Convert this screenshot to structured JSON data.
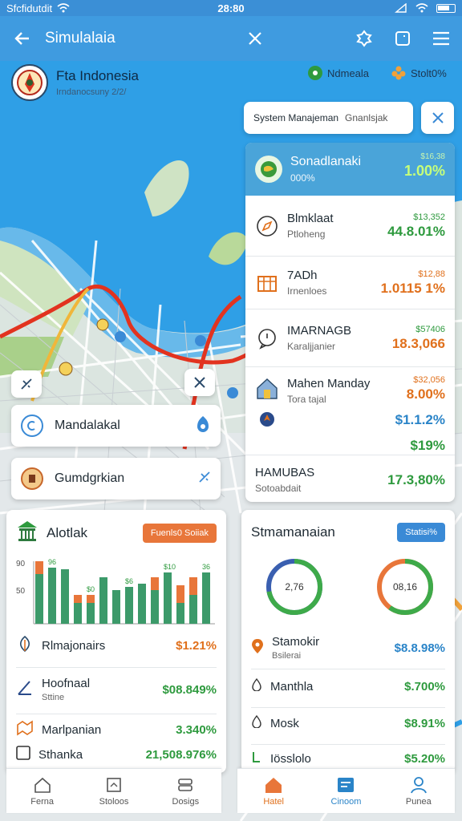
{
  "status_bar": {
    "carrier": "Sfcfidutdit",
    "time": "28:80"
  },
  "app_bar": {
    "title": "Simulalaia"
  },
  "location": {
    "title": "Fta Indonesia",
    "subtitle": "Irndanocsuny 2/2/"
  },
  "chips": {
    "left": "Ndmeala",
    "right": "Stolt0%"
  },
  "system_bar": {
    "label": "System Manajeman",
    "muted": "Gnanlsjak"
  },
  "region_list": {
    "header": {
      "title": "Sonadlanaki",
      "subtitle": "000%",
      "small": "$16,38",
      "value": "1.00%"
    },
    "rows": [
      {
        "title": "Blmklaat",
        "subtitle": "Ptloheng",
        "small": "$13,352",
        "value": "44.8.01%",
        "small_color": "#2e9a3e",
        "value_color": "#2e9a3e"
      },
      {
        "title": "7ADh",
        "subtitle": "Irnenloes",
        "small": "$12,88",
        "value": "1.0115 1%",
        "small_color": "#e0701c",
        "value_color": "#e0701c"
      },
      {
        "title": "IMARNAGB",
        "subtitle": "Karaljjanier",
        "small": "$57406",
        "value": "18.3,066",
        "small_color": "#2e9a3e",
        "value_color": "#e0701c"
      },
      {
        "title": "Mahen Manday",
        "subtitle": "Tora tajal",
        "small": "$32,056",
        "value": "8.00%",
        "value2": "$1.1.2%",
        "value3": "$19%",
        "small_color": "#e0701c",
        "value_color": "#e0701c"
      },
      {
        "title": "HAMUBAS",
        "subtitle": "Sotoabdait",
        "small": "",
        "value": "17.3,80%",
        "small_color": "#2e9a3e",
        "value_color": "#2e9a3e"
      }
    ]
  },
  "pills": [
    {
      "label": "Mandalakal"
    },
    {
      "label": "Gumdgrkian"
    }
  ],
  "analytics": {
    "title": "Alotlak",
    "badge": "Fuenls0 Soiiak",
    "y_labels": [
      "90",
      "50"
    ],
    "bar_labels": [
      "96",
      "$0",
      "$6",
      "$10",
      "36"
    ],
    "bars": [
      {
        "green": 62,
        "orange": 16
      },
      {
        "green": 70,
        "orange": 0
      },
      {
        "green": 68,
        "orange": 0
      },
      {
        "green": 26,
        "orange": 10
      },
      {
        "green": 26,
        "orange": 10
      },
      {
        "green": 58,
        "orange": 0
      },
      {
        "green": 42,
        "orange": 0
      },
      {
        "green": 46,
        "orange": 0
      },
      {
        "green": 50,
        "orange": 0
      },
      {
        "green": 42,
        "orange": 16
      },
      {
        "green": 64,
        "orange": 0
      },
      {
        "green": 26,
        "orange": 22
      },
      {
        "green": 36,
        "orange": 22
      },
      {
        "green": 64,
        "orange": 0
      }
    ],
    "rows": [
      {
        "title": "Rlmajonairs",
        "subtitle": "",
        "value": "$1.21%",
        "color": "#e0701c"
      },
      {
        "title": "Hoofnaal",
        "subtitle": "Sttine",
        "value": "$08.849%",
        "color": "#2e9a3e"
      },
      {
        "title": "Marlpanian",
        "subtitle": "",
        "value": "3.340%",
        "color": "#2e9a3e"
      },
      {
        "title": "Sthanka",
        "subtitle": "",
        "value": "21,508.976%",
        "color": "#2e9a3e"
      }
    ]
  },
  "stats": {
    "title": "Stmamanaian",
    "badge": "Statisi%",
    "donut1": {
      "label": "2,76",
      "value": 0.72
    },
    "donut2": {
      "label": "08,16",
      "value": 0.6
    },
    "rows": [
      {
        "title": "Stamokir",
        "subtitle": "Bsilerai",
        "value": "$8.8.98%",
        "color": "#2a84c8"
      },
      {
        "title": "Manthla",
        "subtitle": "",
        "value": "$.700%",
        "color": "#2e9a3e"
      },
      {
        "title": "Mosk",
        "subtitle": "",
        "value": "$8.91%",
        "color": "#2e9a3e"
      },
      {
        "title": "Iösslolo",
        "subtitle": "",
        "value": "$5.20%",
        "color": "#2e9a3e"
      }
    ]
  },
  "nav_left": [
    "Ferna",
    "Stoloos",
    "Dosigs"
  ],
  "nav_right": [
    "Hatel",
    "Cinoom",
    "Punea"
  ]
}
